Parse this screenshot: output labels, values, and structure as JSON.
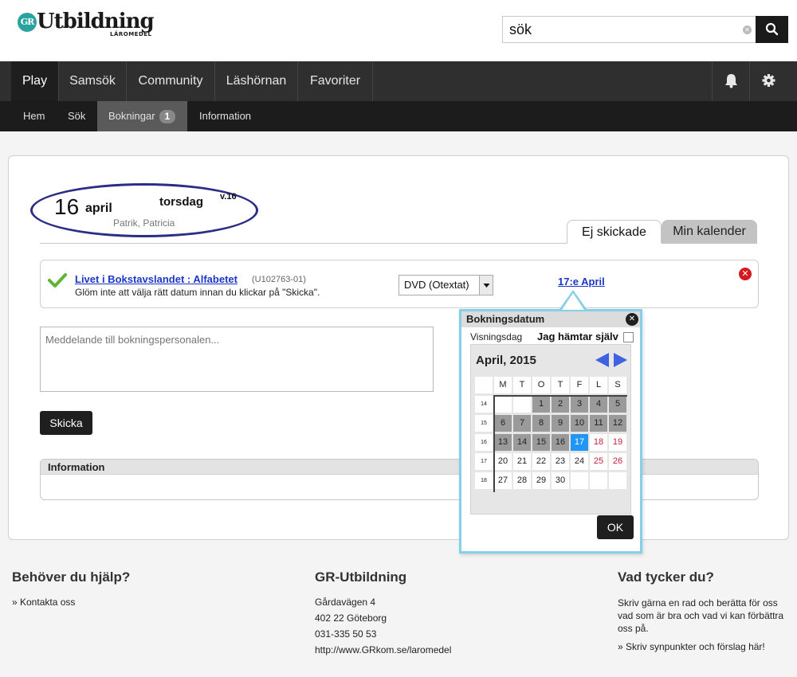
{
  "header": {
    "logo_badge": "GR",
    "logo_text": "Utbildning",
    "logo_sub": "LÄROMEDEL",
    "search_value": "sök"
  },
  "nav": {
    "items": [
      "Play",
      "Samsök",
      "Community",
      "Läshörnan",
      "Favoriter"
    ]
  },
  "subnav": {
    "items": [
      "Hem",
      "Sök",
      "Bokningar",
      "Information"
    ],
    "bookings_count": "1"
  },
  "date": {
    "day": "16",
    "month": "april",
    "weekday": "torsdag",
    "week": "v.16",
    "names": "Patrik, Patricia"
  },
  "tabs": [
    "Ej skickade",
    "Min kalender"
  ],
  "booking": {
    "title": "Livet i Bokstavslandet : Alfabetet",
    "code": "(U102763-01)",
    "note": "Glöm inte att välja rätt datum innan du klickar på \"Skicka\".",
    "format": "DVD (Otextat)",
    "date_link": "17:e April"
  },
  "message_placeholder": "Meddelande till bokningspersonalen...",
  "send_label": "Skicka",
  "info_title": "Information",
  "popup": {
    "title": "Bokningsdatum",
    "vis_label": "Visningsdag",
    "self_label": "Jag hämtar själv",
    "month_title": "April, 2015",
    "day_headers": [
      "M",
      "T",
      "O",
      "T",
      "F",
      "L",
      "S"
    ],
    "weeks": [
      {
        "week": "14",
        "days": [
          "",
          "",
          "1",
          "2",
          "3",
          "4",
          "5"
        ]
      },
      {
        "week": "15",
        "days": [
          "6",
          "7",
          "8",
          "9",
          "10",
          "11",
          "12"
        ]
      },
      {
        "week": "16",
        "days": [
          "13",
          "14",
          "15",
          "16",
          "17",
          "18",
          "19"
        ]
      },
      {
        "week": "17",
        "days": [
          "20",
          "21",
          "22",
          "23",
          "24",
          "25",
          "26"
        ]
      },
      {
        "week": "18",
        "days": [
          "27",
          "28",
          "29",
          "30",
          "",
          "",
          ""
        ]
      }
    ],
    "selected_day": "17",
    "ok_label": "OK"
  },
  "footer": {
    "help_title": "Behöver du hjälp?",
    "help_link": "» Kontakta oss",
    "org_title": "GR-Utbildning",
    "org_lines": [
      "Gårdavägen 4",
      "402 22 Göteborg",
      "031-335 50 53",
      "http://www.GRkom.se/laromedel"
    ],
    "feedback_title": "Vad tycker du?",
    "feedback_text": "Skriv gärna en rad och berätta för oss vad som är bra och vad vi kan förbättra oss på.",
    "feedback_link": "» Skriv synpunkter och förslag här!"
  },
  "colors": {
    "nav_bg": "#2f2f2f",
    "subnav_bg": "#1c1c1c",
    "link": "#1a37c8",
    "popup_border": "#85cfe8",
    "today": "#2196f3",
    "weekend": "#c41e3a"
  }
}
